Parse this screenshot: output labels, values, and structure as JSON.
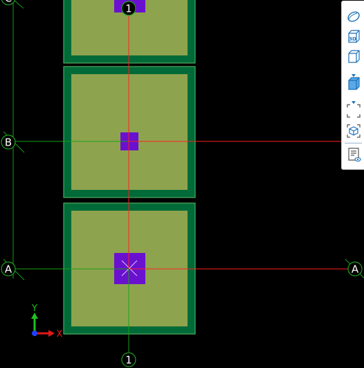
{
  "grid": {
    "axes": [
      {
        "id": "axis-1-top-bubble",
        "label": "1"
      },
      {
        "id": "axis-1-bottom-bubble",
        "label": "1"
      },
      {
        "id": "axis-b-left-bubble",
        "label": "B"
      },
      {
        "id": "axis-a-left-bubble",
        "label": "A"
      },
      {
        "id": "axis-a-right-bubble",
        "label": "A"
      },
      {
        "id": "axis-c-left-bubble",
        "label": "C"
      }
    ]
  },
  "ucs": {
    "x_label": "X",
    "y_label": "Y"
  },
  "colors": {
    "background": "#000000",
    "footing_outer": "#006a38",
    "footing_inner": "#8ea34e",
    "footing_edge": "#5fbf6a",
    "column": "#6a11cf",
    "grid_line_x": "#ff2020",
    "grid_line_y": "#18a018",
    "bubble": "#1fa01f",
    "toolbar_icon": "#1a6fb8"
  },
  "toolbar": {
    "items": [
      {
        "name": "orbit-icon"
      },
      {
        "name": "3d-view-icon",
        "label": "3D"
      },
      {
        "name": "view-cube-icon"
      },
      {
        "name": "shaded-box-icon"
      },
      {
        "name": "zoom-extents-icon"
      },
      {
        "name": "isolate-object-icon"
      },
      {
        "name": "properties-view-icon"
      }
    ]
  }
}
